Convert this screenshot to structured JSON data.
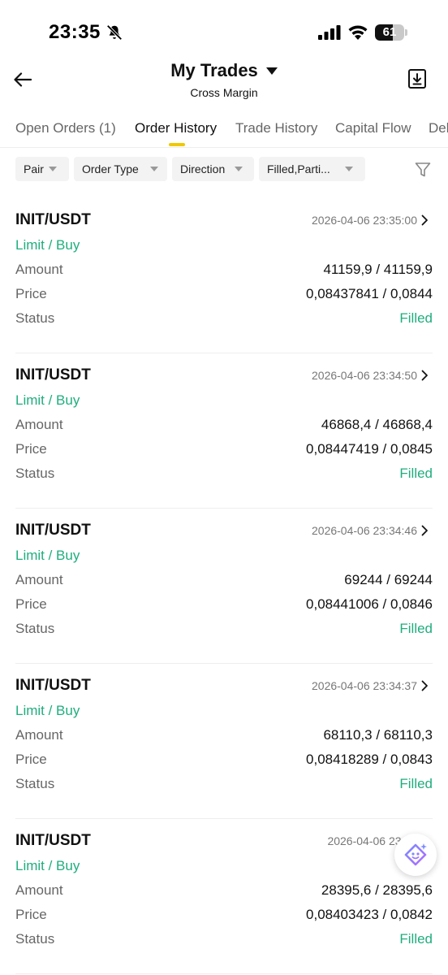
{
  "status_bar": {
    "time": "23:35",
    "battery": "61",
    "battery_level": 0.61
  },
  "header": {
    "title": "My Trades",
    "subtitle": "Cross Margin"
  },
  "tabs": [
    {
      "label": "Open Orders (1)",
      "active": false
    },
    {
      "label": "Order History",
      "active": true
    },
    {
      "label": "Trade History",
      "active": false
    },
    {
      "label": "Capital Flow",
      "active": false
    },
    {
      "label": "Del",
      "active": false
    }
  ],
  "filters": [
    {
      "label": "Pair"
    },
    {
      "label": "Order Type"
    },
    {
      "label": "Direction"
    },
    {
      "label": "Filled,Parti..."
    }
  ],
  "labels": {
    "amount": "Amount",
    "price": "Price",
    "status": "Status"
  },
  "orders": [
    {
      "pair": "INIT/USDT",
      "time": "2026-04-06 23:35:00",
      "type": "Limit / Buy",
      "amount": "41159,9 / 41159,9",
      "price": "0,08437841 / 0,0844",
      "status": "Filled"
    },
    {
      "pair": "INIT/USDT",
      "time": "2026-04-06 23:34:50",
      "type": "Limit / Buy",
      "amount": "46868,4 / 46868,4",
      "price": "0,08447419 / 0,0845",
      "status": "Filled"
    },
    {
      "pair": "INIT/USDT",
      "time": "2026-04-06 23:34:46",
      "type": "Limit / Buy",
      "amount": "69244 / 69244",
      "price": "0,08441006 / 0,0846",
      "status": "Filled"
    },
    {
      "pair": "INIT/USDT",
      "time": "2026-04-06 23:34:37",
      "type": "Limit / Buy",
      "amount": "68110,3 / 68110,3",
      "price": "0,08418289 / 0,0843",
      "status": "Filled"
    },
    {
      "pair": "INIT/USDT",
      "time": "2026-04-06 23:34",
      "type": "Limit / Buy",
      "amount": "28395,6 / 28395,6",
      "price": "0,08403423 / 0,0842",
      "status": "Filled"
    }
  ],
  "colors": {
    "accent_green": "#1fae7d",
    "tab_indicator": "#f0c800"
  },
  "icons": {
    "back": "arrow-left-icon",
    "title_dropdown": "caret-down-icon",
    "download": "download-icon",
    "filter": "funnel-icon",
    "row_chevron": "chevron-right-icon",
    "assistant": "assistant-bot-icon"
  }
}
